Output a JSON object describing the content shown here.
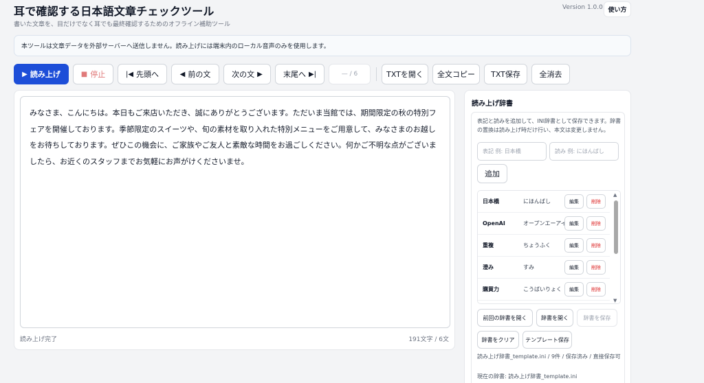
{
  "header": {
    "title": "耳で確認する日本語文章チェックツール",
    "subtitle": "書いた文章を、目だけでなく耳でも最終確認するためのオフライン補助ツール",
    "version": "Version 1.0.0",
    "help_label": "使い方"
  },
  "notice": "本ツールは文章データを外部サーバーへ送信しません。読み上げには端末内のローカル音声のみを使用します。",
  "toolbar": {
    "read_label": "読み上げ",
    "stop_label": "停止",
    "first_label": "先頭へ",
    "prev_label": "前の文",
    "next_label": "次の文",
    "last_label": "末尾へ",
    "counter": "— / 6",
    "open_txt_label": "TXTを開く",
    "copy_all_label": "全文コピー",
    "save_txt_label": "TXT保存",
    "clear_all_label": "全消去"
  },
  "editor": {
    "text": "みなさま、こんにちは。本日もご来店いただき、誠にありがとうございます。ただいま当館では、期間限定の秋の特別フェアを開催しております。季節限定のスイーツや、旬の素材を取り入れた特別メニューをご用意して、みなさまのお越しをお待ちしております。ぜひこの機会に、ご家族やご友人と素敵な時間をお過ごしください。何かご不明な点がございましたら、お近くのスタッフまでお気軽にお声がけくださいませ。",
    "status": "読み上げ完了",
    "count": "191文字 / 6文"
  },
  "dictionary": {
    "title": "読み上げ辞書",
    "description": "表記と読みを追加して、INI辞書として保存できます。辞書の置換は読み上げ時だけ行い、本文は変更しません。",
    "surface_placeholder": "表記 例: 日本橋",
    "reading_placeholder": "読み 例: にほんばし",
    "add_label": "追加",
    "edit_label": "編集",
    "delete_label": "削除",
    "entries": [
      {
        "surface": "日本橋",
        "reading": "にほんばし"
      },
      {
        "surface": "OpenAI",
        "reading": "オープンエーアイ"
      },
      {
        "surface": "重複",
        "reading": "ちょうふく"
      },
      {
        "surface": "澄み",
        "reading": "すみ"
      },
      {
        "surface": "購買力",
        "reading": "こうばいりょく"
      }
    ],
    "buttons": {
      "open_previous": "前回の辞書を開く",
      "open": "辞書を開く",
      "save": "辞書を保存",
      "clear": "辞書をクリア",
      "save_template": "テンプレート保存"
    },
    "file_info": "読み上げ辞書_template.ini / 9件 / 保存済み / 直接保存可",
    "current_dict": "現在の辞書: 読み上げ辞書_template.ini"
  },
  "colors": {
    "primary": "#1d4ed8",
    "danger": "#dc2626",
    "stop": "#e07a7a"
  }
}
